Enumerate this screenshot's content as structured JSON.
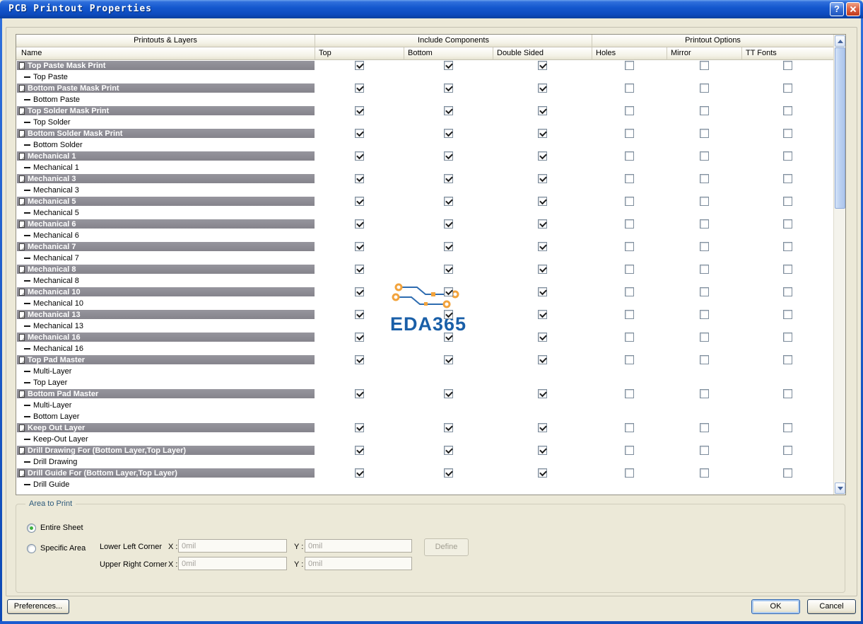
{
  "window": {
    "title": "PCB Printout Properties",
    "help_label": "?"
  },
  "table": {
    "groups": [
      "Printouts & Layers",
      "Include Components",
      "Printout Options"
    ],
    "columns": [
      "Name",
      "Top",
      "Bottom",
      "Double Sided",
      "Holes",
      "Mirror",
      "TT Fonts"
    ],
    "rows": [
      {
        "name": "Top Paste Mask Print",
        "layers": [
          "Top Paste"
        ],
        "checks": [
          true,
          true,
          true,
          false,
          false,
          false
        ]
      },
      {
        "name": "Bottom Paste Mask Print",
        "layers": [
          "Bottom Paste"
        ],
        "checks": [
          true,
          true,
          true,
          false,
          false,
          false
        ]
      },
      {
        "name": "Top Solder Mask Print",
        "layers": [
          "Top Solder"
        ],
        "checks": [
          true,
          true,
          true,
          false,
          false,
          false
        ]
      },
      {
        "name": "Bottom Solder Mask Print",
        "layers": [
          "Bottom Solder"
        ],
        "checks": [
          true,
          true,
          true,
          false,
          false,
          false
        ]
      },
      {
        "name": "Mechanical 1",
        "layers": [
          "Mechanical 1"
        ],
        "checks": [
          true,
          true,
          true,
          false,
          false,
          false
        ]
      },
      {
        "name": "Mechanical 3",
        "layers": [
          "Mechanical 3"
        ],
        "checks": [
          true,
          true,
          true,
          false,
          false,
          false
        ]
      },
      {
        "name": "Mechanical 5",
        "layers": [
          "Mechanical 5"
        ],
        "checks": [
          true,
          true,
          true,
          false,
          false,
          false
        ]
      },
      {
        "name": "Mechanical 6",
        "layers": [
          "Mechanical 6"
        ],
        "checks": [
          true,
          true,
          true,
          false,
          false,
          false
        ]
      },
      {
        "name": "Mechanical 7",
        "layers": [
          "Mechanical 7"
        ],
        "checks": [
          true,
          true,
          true,
          false,
          false,
          false
        ]
      },
      {
        "name": "Mechanical 8",
        "layers": [
          "Mechanical 8"
        ],
        "checks": [
          true,
          true,
          true,
          false,
          false,
          false
        ]
      },
      {
        "name": "Mechanical 10",
        "layers": [
          "Mechanical 10"
        ],
        "checks": [
          true,
          true,
          true,
          false,
          false,
          false
        ]
      },
      {
        "name": "Mechanical 13",
        "layers": [
          "Mechanical 13"
        ],
        "checks": [
          true,
          true,
          true,
          false,
          false,
          false
        ]
      },
      {
        "name": "Mechanical 16",
        "layers": [
          "Mechanical 16"
        ],
        "checks": [
          true,
          true,
          true,
          false,
          false,
          false
        ]
      },
      {
        "name": "Top Pad Master",
        "layers": [
          "Multi-Layer",
          "Top Layer"
        ],
        "checks": [
          true,
          true,
          true,
          false,
          false,
          false
        ]
      },
      {
        "name": "Bottom Pad Master",
        "layers": [
          "Multi-Layer",
          "Bottom Layer"
        ],
        "checks": [
          true,
          true,
          true,
          false,
          false,
          false
        ]
      },
      {
        "name": "Keep Out Layer",
        "layers": [
          "Keep-Out Layer"
        ],
        "checks": [
          true,
          true,
          true,
          false,
          false,
          false
        ]
      },
      {
        "name": "Drill Drawing For (Bottom Layer,Top Layer)",
        "layers": [
          "Drill Drawing"
        ],
        "checks": [
          true,
          true,
          true,
          false,
          false,
          false
        ]
      },
      {
        "name": "Drill Guide For (Bottom Layer,Top Layer)",
        "layers": [
          "Drill Guide"
        ],
        "checks": [
          true,
          true,
          true,
          false,
          false,
          false
        ]
      }
    ]
  },
  "watermark": {
    "text": "EDA365"
  },
  "area_to_print": {
    "title": "Area to Print",
    "entire_sheet_label": "Entire Sheet",
    "specific_area_label": "Specific Area",
    "lower_left_corner_label": "Lower Left Corner",
    "upper_right_corner_label": "Upper Right Corner",
    "x_label": "X :",
    "y_label": "Y :",
    "lower_left_x": "0mil",
    "lower_left_y": "0mil",
    "upper_right_x": "0mil",
    "upper_right_y": "0mil",
    "define_label": "Define",
    "entire_sheet_selected": true,
    "specific_area_selected": false
  },
  "footer": {
    "preferences_label": "Preferences...",
    "ok_label": "OK",
    "cancel_label": "Cancel"
  },
  "colors": {
    "titlebar_blue": "#1558CE",
    "printout_bar_gray": "#8B8A91",
    "watermark_blue": "#1A5FA8",
    "watermark_orange": "#F2A33C",
    "radio_selected_green": "#3DB03D"
  }
}
